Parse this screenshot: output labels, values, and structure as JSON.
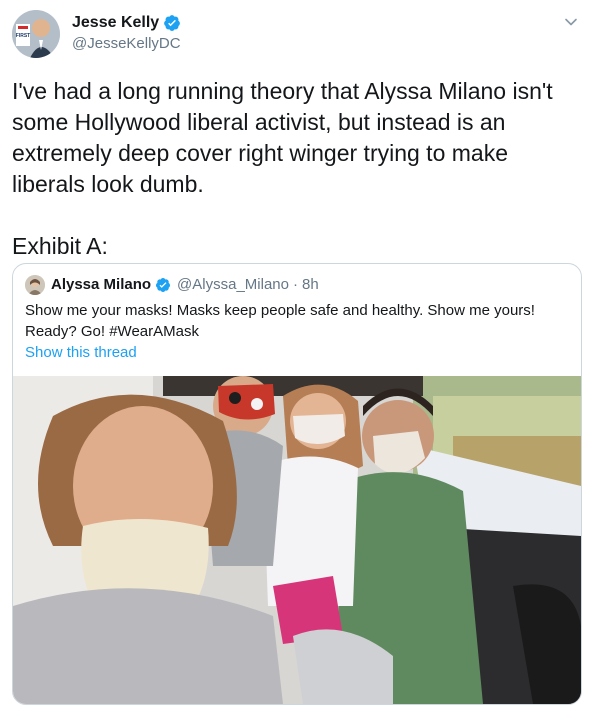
{
  "tweet": {
    "display_name": "Jesse Kelly",
    "handle": "@JesseKellyDC",
    "text": "I've had a long running theory that Alyssa Milano isn't some Hollywood liberal activist, but instead is an extremely deep cover right winger trying to make liberals look dumb.",
    "exhibit": "Exhibit A:",
    "avatar_badge": "FIRST",
    "caret_icon": "chevron-down-icon",
    "verified_icon": "verified-badge-icon"
  },
  "quoted_tweet": {
    "display_name": "Alyssa Milano",
    "handle": "@Alyssa_Milano",
    "separator": "·",
    "time": "8h",
    "text": "Show me your masks! Masks keep people safe and healthy. Show me yours! Ready? Go! #WearAMask",
    "thread_link": "Show this thread",
    "photo_icon": "selfie-photo"
  },
  "colors": {
    "text": "#14171a",
    "secondary": "#657786",
    "link": "#1da1f2",
    "border": "#ccd6dd"
  }
}
